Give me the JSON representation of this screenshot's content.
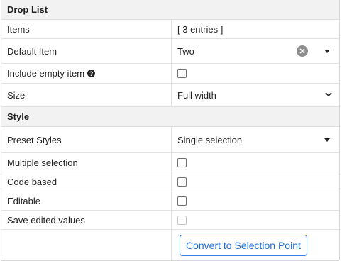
{
  "drop_list_section": {
    "title": "Drop List",
    "rows": {
      "items": {
        "label": "Items",
        "value": "[ 3 entries ]"
      },
      "default_item": {
        "label": "Default Item",
        "value": "Two"
      },
      "include_empty": {
        "label": "Include empty item",
        "checked": false
      },
      "size": {
        "label": "Size",
        "value": "Full width"
      }
    }
  },
  "style_section": {
    "title": "Style",
    "rows": {
      "preset_styles": {
        "label": "Preset Styles",
        "value": "Single selection"
      },
      "multiple_selection": {
        "label": "Multiple selection",
        "checked": false
      },
      "code_based": {
        "label": "Code based",
        "checked": false
      },
      "editable": {
        "label": "Editable",
        "checked": false
      },
      "save_edited": {
        "label": "Save edited values",
        "checked": false,
        "disabled": true
      }
    },
    "convert_button": "Convert to Selection Point"
  },
  "icons": {
    "help": "question-circle-icon",
    "clear": "clear-circle-icon",
    "dropdown": "caret-down-icon",
    "select": "chevron-down-icon"
  },
  "colors": {
    "section_bg": "#f2f2f2",
    "accent": "#1d6fd8",
    "border": "#e2e2e2"
  }
}
